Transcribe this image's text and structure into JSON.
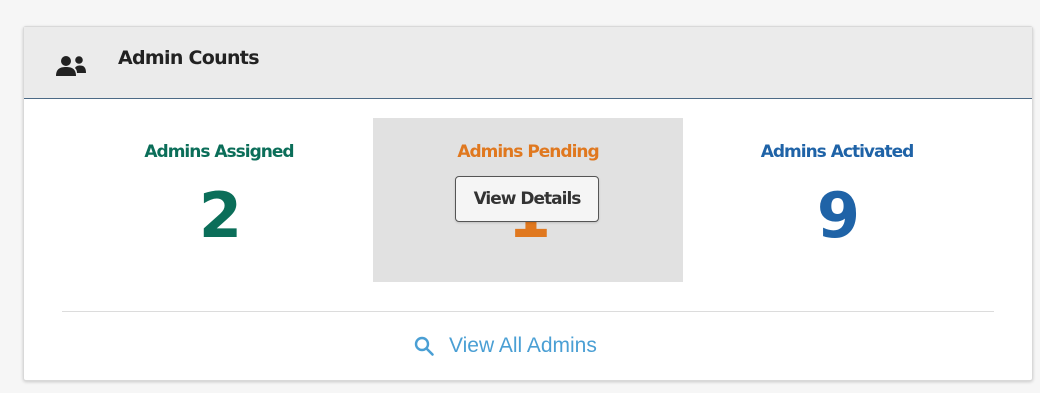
{
  "card": {
    "title": "Admin Counts",
    "header_icon": "users-icon"
  },
  "stats": [
    {
      "label": "Admins Assigned",
      "value": "2",
      "color": "#0b6e59"
    },
    {
      "label": "Admins Pending",
      "value": "1",
      "color": "#e0781f"
    },
    {
      "label": "Admins Activated",
      "value": "9",
      "color": "#1f63a7"
    }
  ],
  "pending_overlay": {
    "button_label": "View Details"
  },
  "footer": {
    "link_label": "View All Admins",
    "link_icon": "search-icon",
    "link_color": "#4a9fd4"
  }
}
